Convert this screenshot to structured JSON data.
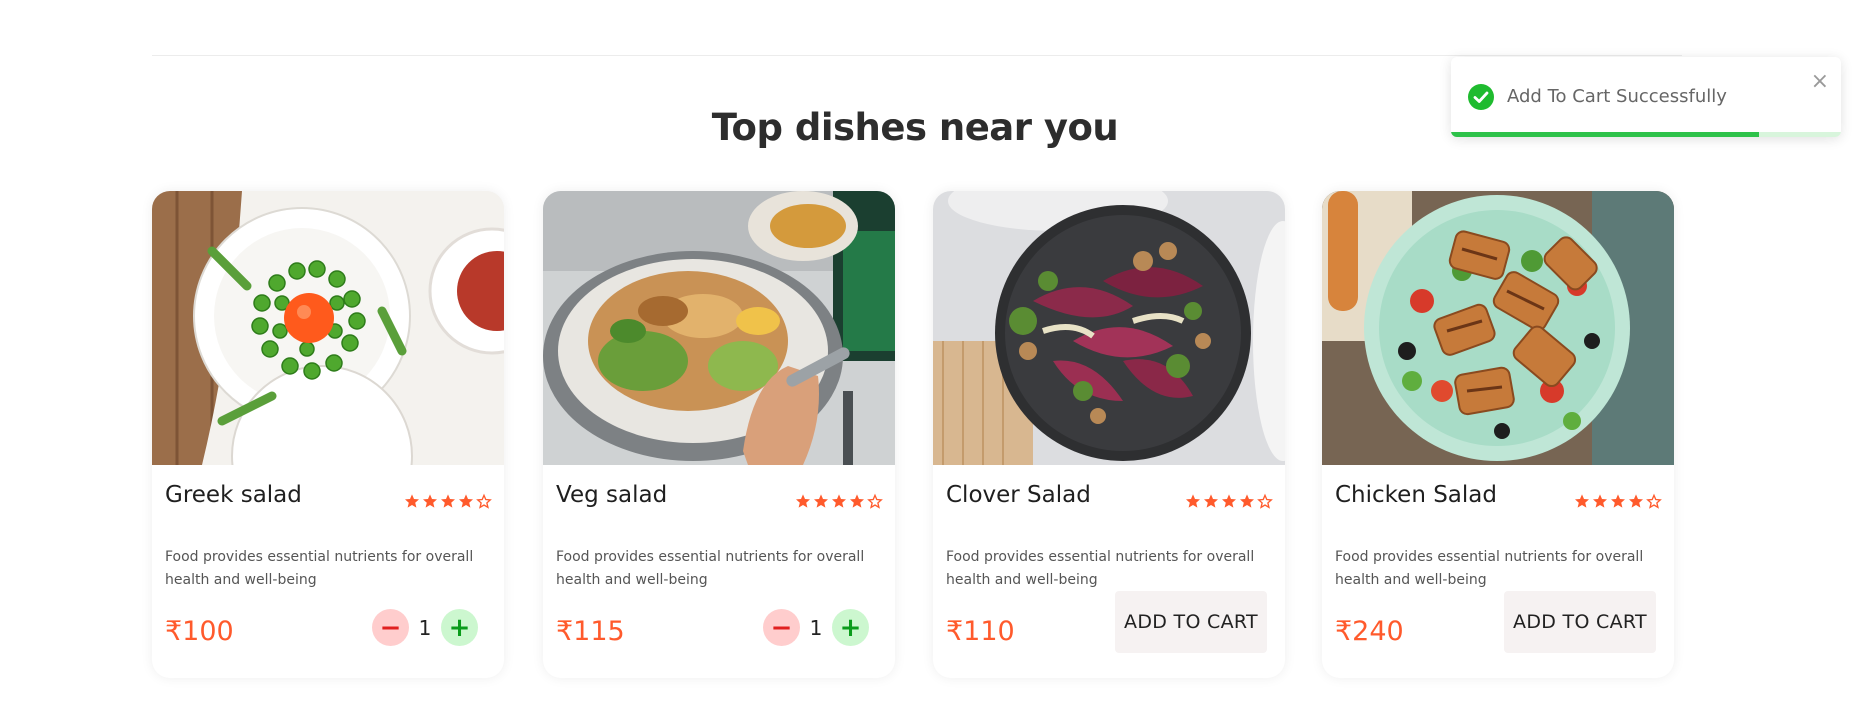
{
  "section": {
    "title": "Top dishes near you"
  },
  "toast": {
    "message": "Add To Cart Successfully",
    "progress": 0.79,
    "success_color": "#2ec24a",
    "icon": "check-circle-icon",
    "close_icon": "close-icon"
  },
  "cart_button_label": "ADD TO CART",
  "rating_color": "#ff5a2c",
  "dishes": [
    {
      "name": "Greek salad",
      "rating": 4,
      "rating_max": 5,
      "description": "Food provides essential nutrients for overall health and well-being",
      "price": "₹100",
      "quantity": "1",
      "in_cart": true
    },
    {
      "name": "Veg salad",
      "rating": 4,
      "rating_max": 5,
      "description": "Food provides essential nutrients for overall health and well-being",
      "price": "₹115",
      "quantity": "1",
      "in_cart": true
    },
    {
      "name": "Clover Salad",
      "rating": 4,
      "rating_max": 5,
      "description": "Food provides essential nutrients for overall health and well-being",
      "price": "₹110",
      "in_cart": false
    },
    {
      "name": "Chicken Salad",
      "rating": 4,
      "rating_max": 5,
      "description": "Food provides essential nutrients for overall health and well-being",
      "price": "₹240",
      "in_cart": false
    }
  ]
}
